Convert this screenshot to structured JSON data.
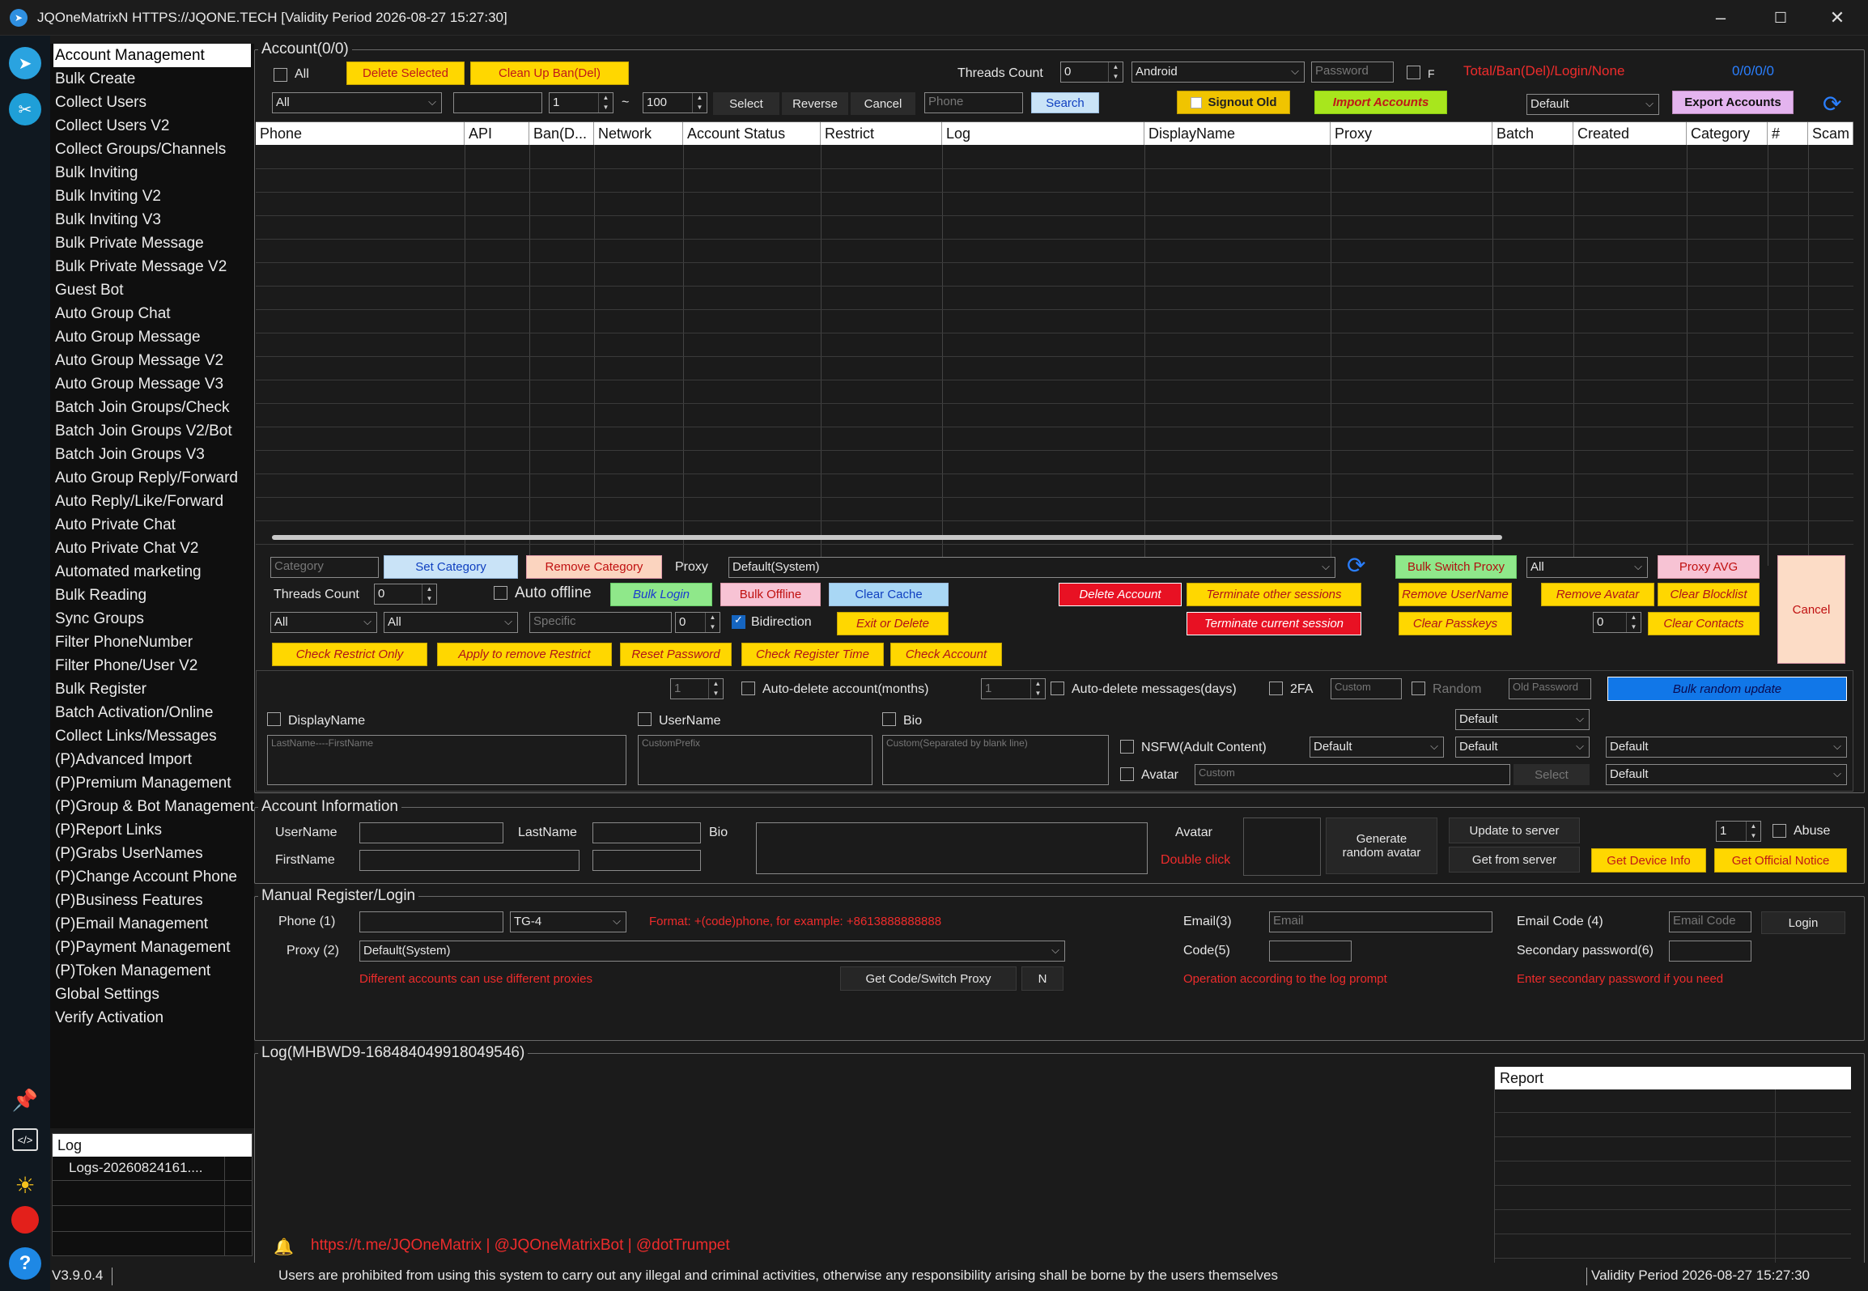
{
  "window": {
    "title": "JQOneMatrixN HTTPS://JQONE.TECH  [Validity Period 2026-08-27 15:27:30]"
  },
  "nav": [
    "Account Management",
    "Bulk Create",
    "Collect Users",
    "Collect Users V2",
    "Collect Groups/Channels",
    "Bulk Inviting",
    "Bulk Inviting V2",
    "Bulk Inviting V3",
    "Bulk Private Message",
    "Bulk Private Message V2",
    "Guest Bot",
    "Auto Group Chat",
    "Auto Group Message",
    "Auto Group Message V2",
    "Auto Group Message V3",
    "Batch Join Groups/Check",
    "Batch Join Groups V2/Bot",
    "Batch Join Groups V3",
    "Auto Group Reply/Forward",
    "Auto Reply/Like/Forward",
    "Auto Private Chat",
    "Auto Private Chat V2",
    "Automated marketing",
    "Bulk Reading",
    "Sync Groups",
    "Filter PhoneNumber",
    "Filter Phone/User V2",
    "Bulk Register",
    "Batch Activation/Online",
    "Collect Links/Messages",
    "(P)Advanced Import",
    "(P)Premium Management",
    "(P)Group & Bot Management",
    "(P)Report Links",
    "(P)Grabs UserNames",
    "(P)Change Account Phone",
    "(P)Business Features",
    "(P)Email Management",
    "(P)Payment Management",
    "(P)Token Management",
    "Global Settings",
    "Verify Activation"
  ],
  "log_panel": {
    "header": "Log",
    "item": "Logs-20260824161...."
  },
  "account": {
    "legend": "Account(0/0)",
    "all": "All",
    "delete_selected": "Delete Selected",
    "clean_up": "Clean Up Ban(Del)",
    "threads_label": "Threads Count",
    "threads": "0",
    "platform": "Android",
    "password_ph": "Password",
    "f": "F",
    "totals_label": "Total/Ban(Del)/Login/None",
    "totals": "0/0/0/0",
    "filter": "All",
    "from": "1",
    "tilde": "~",
    "to": "100",
    "select": "Select",
    "reverse": "Reverse",
    "cancel": "Cancel",
    "phone_ph": "Phone",
    "search": "Search",
    "signout": "Signout Old",
    "import": "Import Accounts",
    "default": "Default",
    "export": "Export Accounts",
    "columns": [
      "Phone",
      "API",
      "Ban(D...",
      "Network",
      "Account Status",
      "Restrict",
      "Log",
      "DisplayName",
      "Proxy",
      "Batch",
      "Created",
      "Category",
      "#",
      "Scam"
    ]
  },
  "ops": {
    "category_ph": "Category",
    "set_category": "Set Category",
    "remove_category": "Remove Category",
    "proxy_label": "Proxy",
    "proxy_value": "Default(System)",
    "bulk_switch_proxy": "Bulk Switch Proxy",
    "all": "All",
    "proxy_avg": "Proxy AVG",
    "cancel": "Cancel",
    "threads_label": "Threads Count",
    "threads": "0",
    "auto_offline": "Auto offline",
    "bulk_login": "Bulk Login",
    "bulk_offline": "Bulk Offline",
    "clear_cache": "Clear Cache",
    "delete_account": "Delete Account",
    "terminate_other": "Terminate other sessions",
    "remove_username": "Remove UserName",
    "remove_avatar": "Remove Avatar",
    "clear_blocklist": "Clear Blocklist",
    "all1": "All",
    "all2": "All",
    "specific_ph": "Specific",
    "n0": "0",
    "bidirection": "Bidirection",
    "exit_delete": "Exit or Delete",
    "terminate_current": "Terminate current session",
    "clear_passkeys": "Clear Passkeys",
    "n1": "0",
    "clear_contacts": "Clear Contacts",
    "check_restrict": "Check Restrict Only",
    "apply_remove": "Apply to remove Restrict",
    "reset_password": "Reset Password",
    "check_register": "Check Register Time",
    "check_account": "Check Account"
  },
  "profile": {
    "n1": "1",
    "auto_del_account": "Auto-delete account(months)",
    "n2": "1",
    "auto_del_messages": "Auto-delete messages(days)",
    "twofa": "2FA",
    "custom_ph": "Custom",
    "random": "Random",
    "oldpw_ph": "Old Password",
    "bulk_random": "Bulk random update",
    "displayname": "DisplayName",
    "username": "UserName",
    "bio": "Bio",
    "default": "Default",
    "dn_ph": "LastName----FirstName",
    "un_ph": "CustomPrefix",
    "bio_ph": "Custom(Separated by blank line)",
    "nsfw": "NSFW(Adult Content)",
    "d1": "Default",
    "d2": "Default",
    "d3": "Default",
    "avatar": "Avatar",
    "custom2_ph": "Custom",
    "select": "Select",
    "d4": "Default"
  },
  "info": {
    "legend": "Account Information",
    "username": "UserName",
    "lastname": "LastName",
    "bio": "Bio",
    "firstname": "FirstName",
    "avatar": "Avatar",
    "double_click": "Double click",
    "generate1": "Generate",
    "generate2": "random avatar",
    "update": "Update to server",
    "get": "Get from server",
    "n": "1",
    "abuse": "Abuse",
    "device": "Get Device Info",
    "notice": "Get Official Notice"
  },
  "manual": {
    "legend": "Manual Register/Login",
    "phone": "Phone (1)",
    "tg": "TG-4",
    "format": "Format: +(code)phone,  for example: +8613888888888",
    "email": "Email(3)",
    "email_ph": "Email",
    "email_code": "Email Code (4)",
    "email_code_ph": "Email Code",
    "login": "Login",
    "proxy": "Proxy (2)",
    "proxy_value": "Default(System)",
    "code": "Code(5)",
    "secondary": "Secondary password(6)",
    "diff": "Different accounts can use different proxies",
    "get_code": "Get Code/Switch Proxy",
    "n": "N",
    "op": "Operation according to the log prompt",
    "enter": "Enter secondary password if you need"
  },
  "log": {
    "legend": "Log(MHBWD9-168484049918049546)",
    "report": "Report"
  },
  "footer": {
    "links": "https://t.me/JQOneMatrix | @JQOneMatrixBot | @dotTrumpet",
    "version": "V3.9.0.4",
    "warning": "Users are prohibited from using this system to carry out any illegal and criminal activities, otherwise any responsibility arising shall be borne by the users themselves",
    "validity": "Validity Period 2026-08-27 15:27:30"
  },
  "colors": {
    "accent_yellow": "#ffd700",
    "accent_red": "#e81123",
    "bg": "#1b1b1b"
  }
}
